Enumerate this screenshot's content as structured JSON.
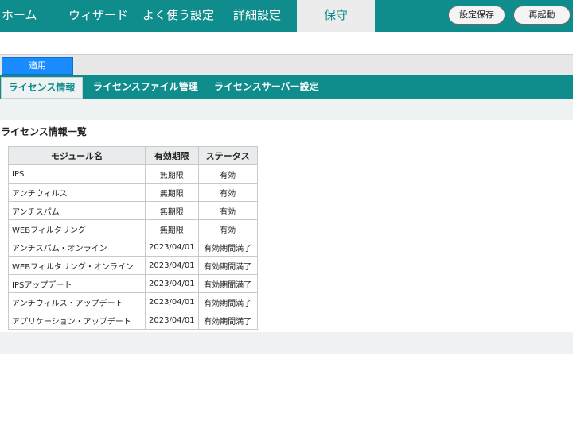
{
  "topnav": {
    "home": "ホーム",
    "wizard": "ウィザード",
    "favorites": "よく使う設定",
    "advanced": "詳細設定",
    "maintenance": "保守",
    "save_settings": "設定保存",
    "restart": "再起動"
  },
  "apply_label": "適用",
  "tabs": [
    {
      "label": "ライセンス情報",
      "active": true
    },
    {
      "label": "ライセンスファイル管理",
      "active": false
    },
    {
      "label": "ライセンスサーバー設定",
      "active": false
    }
  ],
  "section_title": "ライセンス情報一覧",
  "table": {
    "headers": [
      "モジュール名",
      "有効期限",
      "ステータス"
    ],
    "rows": [
      [
        "IPS",
        "無期限",
        "有効"
      ],
      [
        "アンチウィルス",
        "無期限",
        "有効"
      ],
      [
        "アンチスパム",
        "無期限",
        "有効"
      ],
      [
        "WEBフィルタリング",
        "無期限",
        "有効"
      ],
      [
        "アンチスパム・オンライン",
        "2023/04/01",
        "有効期間満了"
      ],
      [
        "WEBフィルタリング・オンライン",
        "2023/04/01",
        "有効期間満了"
      ],
      [
        "IPSアップデート",
        "2023/04/01",
        "有効期間満了"
      ],
      [
        "アンチウィルス・アップデート",
        "2023/04/01",
        "有効期間満了"
      ],
      [
        "アプリケーション・アップデート",
        "2023/04/01",
        "有効期間満了"
      ]
    ]
  },
  "colors": {
    "brand_teal": "#0f8c8c",
    "apply_blue": "#1a8cff"
  }
}
